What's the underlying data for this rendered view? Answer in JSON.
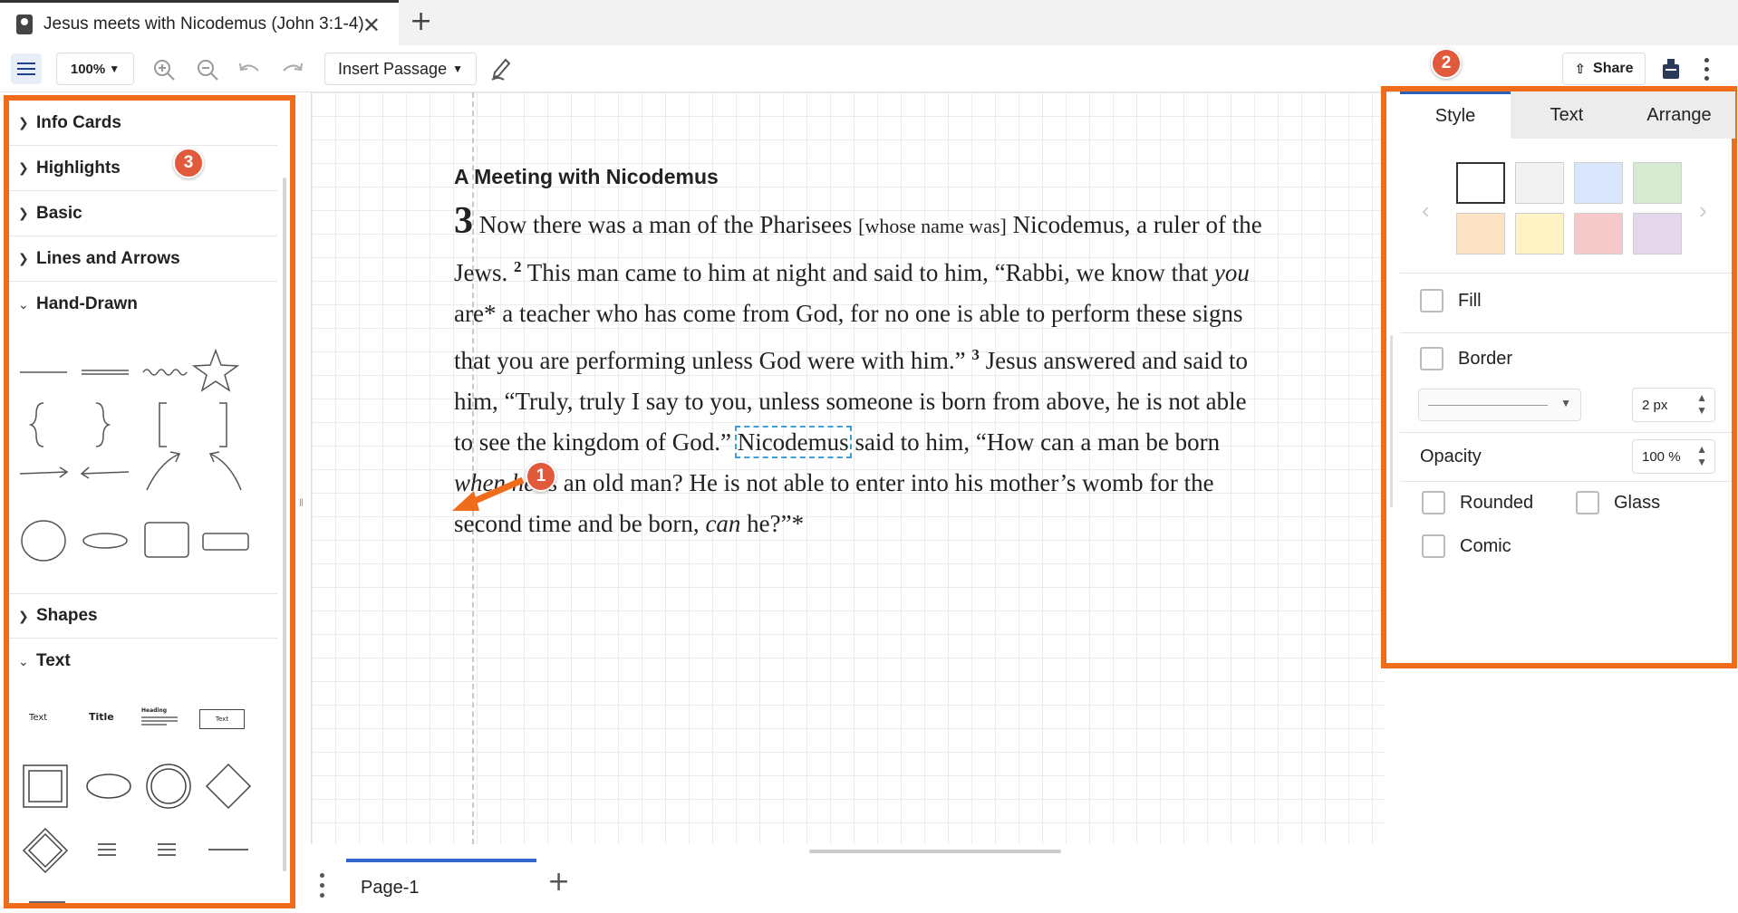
{
  "tab": {
    "title": "Jesus meets with Nicodemus (John 3:1-4)",
    "close_glyph": "✕",
    "new_glyph": "+"
  },
  "toolbar": {
    "zoom": "100%",
    "insert_passage": "Insert Passage",
    "share": "Share"
  },
  "callouts": [
    "1",
    "2",
    "3"
  ],
  "left_panel": {
    "sections": [
      "Info Cards",
      "Highlights",
      "Basic",
      "Lines and Arrows",
      "Hand-Drawn",
      "Shapes",
      "Text"
    ],
    "text_samples": {
      "text": "Text",
      "title": "Title",
      "heading": "Heading",
      "box": "Text"
    }
  },
  "passage": {
    "title": "A Meeting with Nicodemus",
    "chapter": "3",
    "v1a": " Now there was a man of the Pharisees ",
    "bracket": "[whose name was]",
    "v1b": " Nicodemus, a ruler of the Jews. ",
    "v2_num": "2",
    "v2a": " This man came to him at night and said to him, “Rabbi, we know that ",
    "you": "you",
    "v2b": " are* a teacher who has come from God, for no one is able to perform these signs that you are performing unless God were with him.” ",
    "v3_num": "3",
    "v3": " Jesus answered and said to him, “Truly, truly I say to you, unless someone is born from above, he is not able to see the kingdom of God.” ",
    "selected_word": "Nicodemus",
    "v4a": " said to him, “How can a man be born ",
    "when_he": "when he",
    "v4b": " is an old man? He is not able to enter into his mother’s womb for the second time and be born, ",
    "can": "can",
    "v4c": " he?”*"
  },
  "right_panel": {
    "tabs": [
      "Style",
      "Text",
      "Arrange"
    ],
    "swatches": [
      "#ffffff",
      "#f2f2f2",
      "#d9e6fb",
      "#d6ead2",
      "#fde3c4",
      "#fdf3c4",
      "#f5c9ca",
      "#e4d7ec"
    ],
    "fill": "Fill",
    "border": "Border",
    "border_width": "2 px",
    "opacity_label": "Opacity",
    "opacity": "100 %",
    "rounded": "Rounded",
    "glass": "Glass",
    "comic": "Comic"
  },
  "bottom": {
    "page_tab": "Page-1",
    "add_glyph": "+"
  }
}
